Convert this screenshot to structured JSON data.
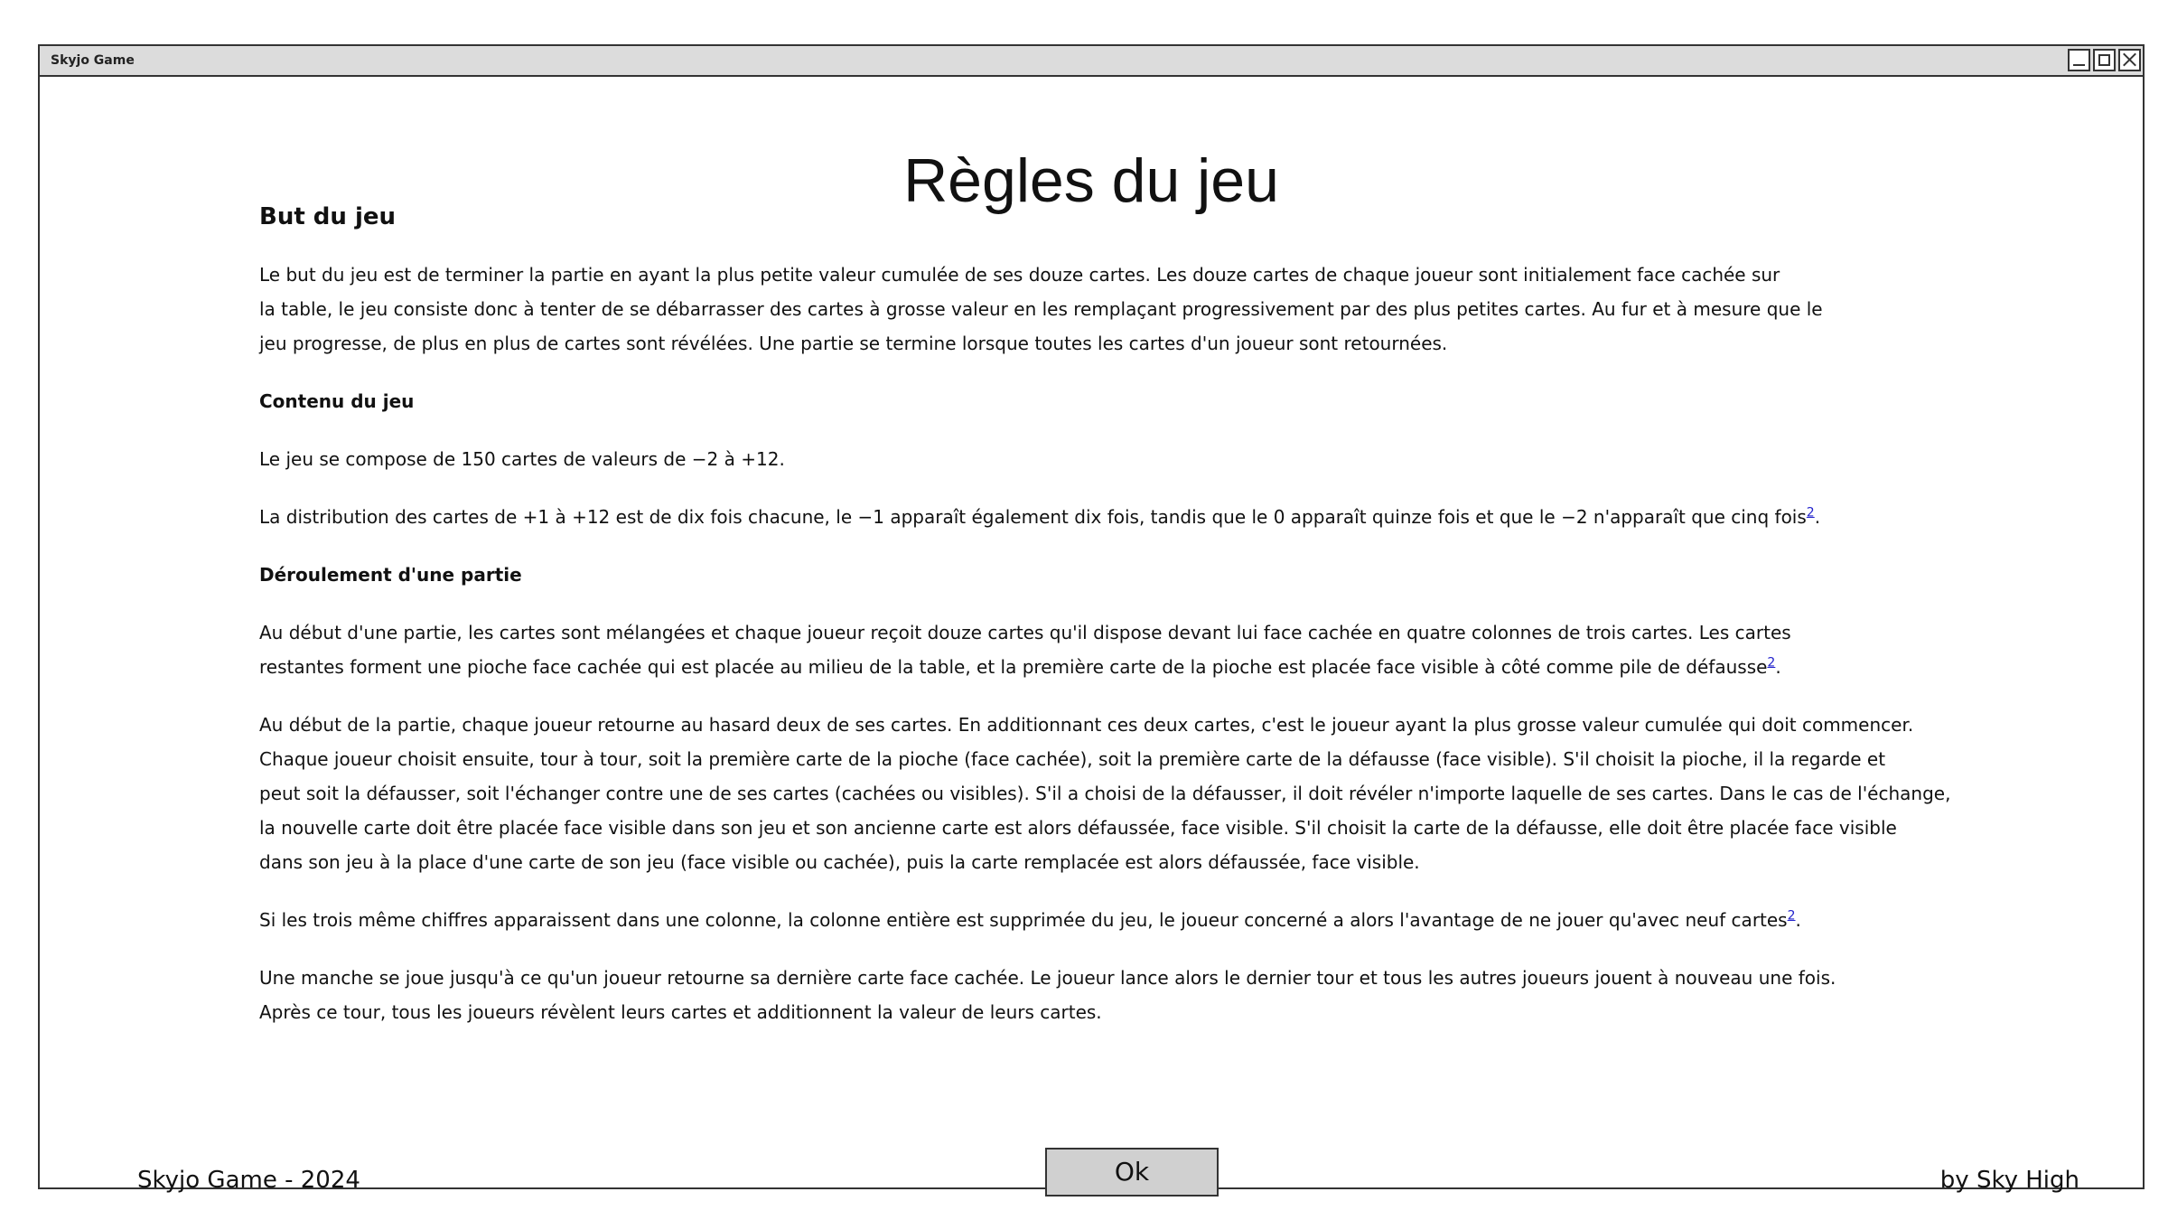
{
  "window": {
    "title": "Skyjo Game",
    "controls": [
      "minimize",
      "maximize",
      "close"
    ]
  },
  "page_title": "Règles du jeu",
  "sections": {
    "but": {
      "heading": "But du jeu",
      "text": "Le but du jeu est de terminer la partie en ayant la plus petite valeur cumulée de ses douze cartes. Les douze cartes de chaque joueur sont initialement face cachée sur\nla table, le jeu consiste donc à tenter de se débarrasser des cartes à grosse valeur en les remplaçant progressivement par des plus petites cartes. Au fur et à mesure que le\n jeu progresse, de plus en plus de cartes sont révélées. Une partie se termine lorsque toutes les cartes d'un joueur sont retournées."
    },
    "contenu": {
      "heading": "Contenu du jeu",
      "text1": "Le jeu se compose de 150 cartes de valeurs de −2 à +12.",
      "text2": "La distribution des cartes de +1 à +12 est de dix fois chacune, le −1 apparaît également dix fois, tandis que le 0 apparaît quinze fois et que le −2 n'apparaît que cinq fois",
      "footnote": "2"
    },
    "deroulement": {
      "heading": "Déroulement d'une partie",
      "p1": "Au début d'une partie, les cartes sont mélangées et chaque joueur reçoit douze cartes qu'il dispose devant lui face cachée en quatre colonnes de trois cartes. Les cartes\nrestantes forment une pioche face cachée qui est placée au milieu de la table, et la première carte de la pioche est placée face visible à côté comme pile de défausse",
      "p1_footnote": "2",
      "p2": "Au début de la partie, chaque joueur retourne au hasard deux de ses cartes. En additionnant ces deux cartes, c'est le joueur ayant la plus grosse valeur cumulée qui doit commencer.\nChaque joueur choisit ensuite, tour à tour, soit la première carte de la pioche (face cachée), soit la première carte de la défausse (face visible). S'il choisit la pioche, il la regarde et\npeut soit la défausser, soit l'échanger contre une de ses cartes (cachées ou visibles). S'il a choisi de la défausser, il doit révéler n'importe laquelle de ses cartes. Dans le cas de l'échange,\nla nouvelle carte doit être placée face visible dans son jeu et son ancienne carte est alors défaussée, face visible. S'il choisit la carte de la défausse, elle doit être placée face visible\n dans son jeu à la place d'une carte de son jeu (face visible ou cachée), puis la carte remplacée est alors défaussée, face visible.",
      "p3": "Si les trois même chiffres apparaissent dans une colonne, la colonne entière est supprimée du jeu, le joueur concerné a alors l'avantage de ne jouer qu'avec neuf cartes",
      "p3_footnote": "2",
      "p4": "Une manche se joue jusqu'à ce qu'un joueur retourne sa dernière carte face cachée. Le joueur lance alors le dernier tour et tous les autres joueurs jouent à nouveau une fois.\nAprès ce tour, tous les joueurs révèlent leurs cartes et additionnent la valeur de leurs cartes."
    }
  },
  "footer": {
    "left": "Skyjo Game - 2024",
    "right": "by Sky High",
    "ok_label": "Ok"
  },
  "period": "."
}
